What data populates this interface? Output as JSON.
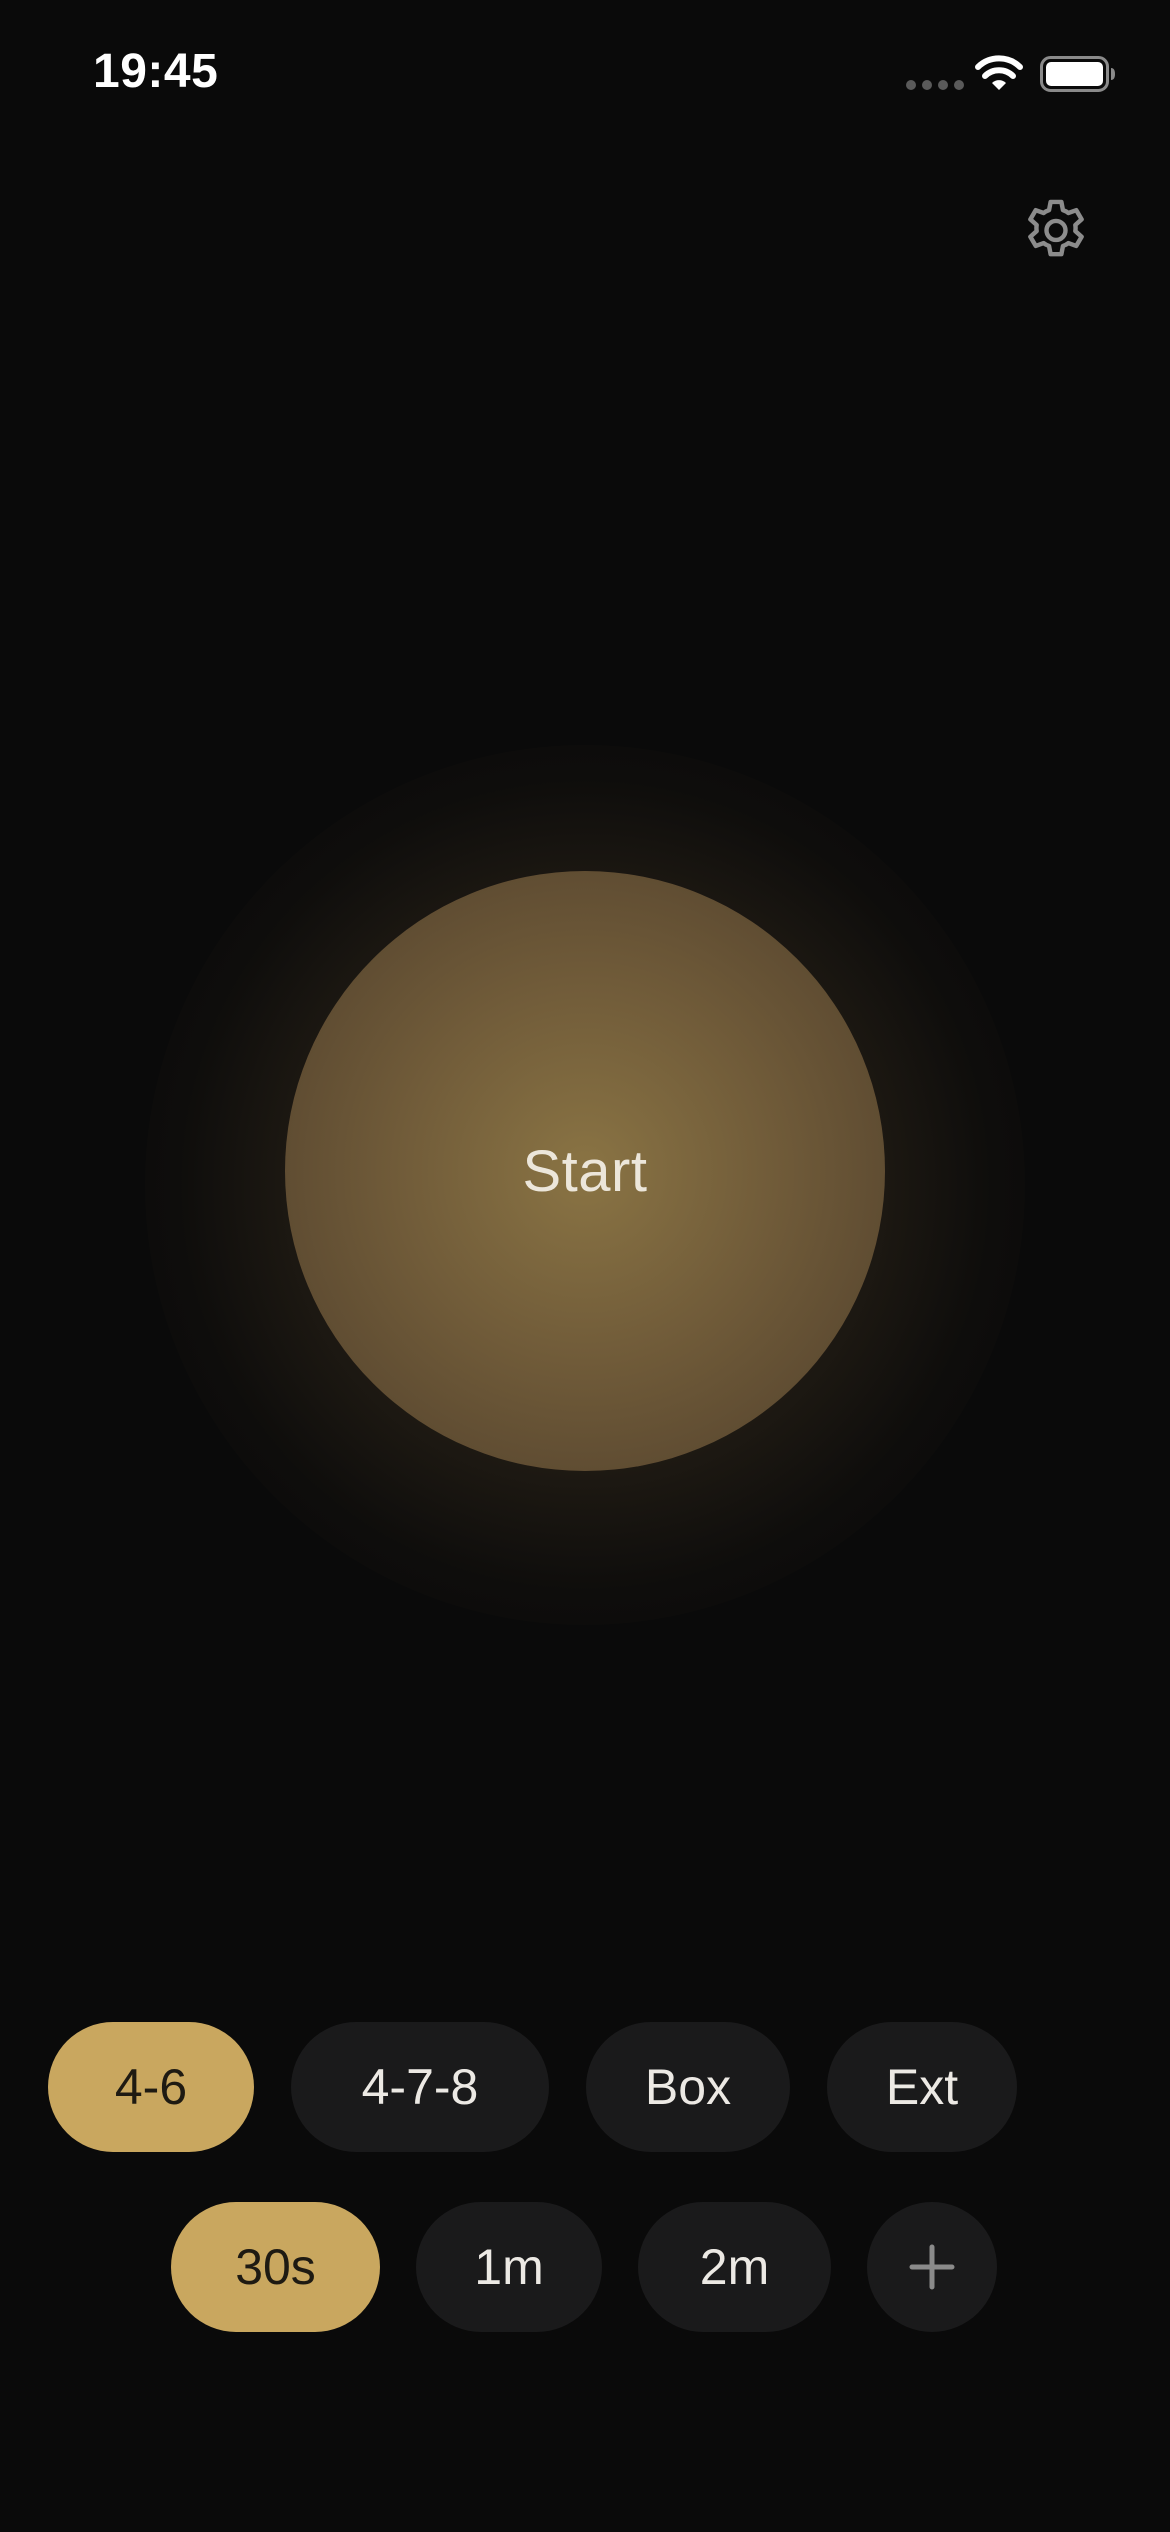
{
  "status_bar": {
    "time": "19:45"
  },
  "icons": {
    "settings": "gear-icon",
    "wifi": "wifi-icon",
    "battery": "battery-icon",
    "add": "plus-icon"
  },
  "breath_button": {
    "label": "Start"
  },
  "patterns": [
    {
      "label": "4-6",
      "selected": true
    },
    {
      "label": "4-7-8",
      "selected": false
    },
    {
      "label": "Box",
      "selected": false
    },
    {
      "label": "Ext",
      "selected": false
    }
  ],
  "durations": [
    {
      "label": "30s",
      "selected": true
    },
    {
      "label": "1m",
      "selected": false
    },
    {
      "label": "2m",
      "selected": false
    }
  ],
  "colors": {
    "background": "#0a0a0a",
    "accent": "#c9a75f",
    "pill": "#1a1a1b",
    "circle": "#705b39"
  }
}
